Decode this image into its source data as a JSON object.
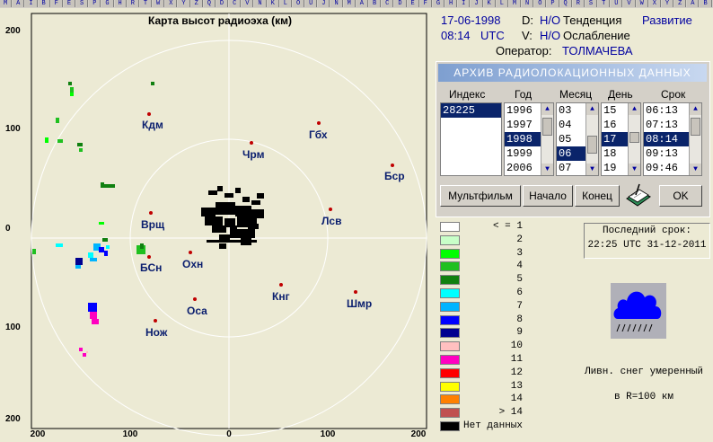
{
  "toolbar": {
    "icons": [
      "M",
      "A",
      "I",
      "B",
      "F",
      "E",
      "S",
      "P",
      "G",
      "H",
      "R",
      "T",
      "W",
      "X",
      "Y",
      "Z",
      "Q",
      "D",
      "C",
      "V",
      "N",
      "K",
      "L",
      "O",
      "U",
      "J",
      "N",
      "M",
      "A",
      "B",
      "C",
      "D",
      "E",
      "F",
      "G",
      "H",
      "I",
      "J",
      "K",
      "L",
      "M",
      "N",
      "O",
      "P",
      "Q",
      "R",
      "S",
      "T",
      "U",
      "V",
      "W",
      "X",
      "Y",
      "Z",
      "A",
      "B"
    ]
  },
  "map": {
    "title": "Карта высот радиоэха (км)",
    "y_ticks": [
      "200",
      "100",
      "0",
      "100",
      "200"
    ],
    "x_ticks": [
      "200",
      "100",
      "0",
      "100",
      "200"
    ],
    "stations": [
      "Кдм",
      "Гбх",
      "Чрм",
      "Бср",
      "Врщ",
      "Лсв",
      "БСн",
      "Охн",
      "Кнг",
      "Шмр",
      "Оса",
      "Нож"
    ]
  },
  "info": {
    "date": "17-06-1998",
    "time": "08:14",
    "utc": "UTC",
    "d_label": "D:",
    "d_value": "Н/О",
    "tendency_label": "Тенденция",
    "tendency_value": "Развитие",
    "v_label": "V:",
    "v_value": "Н/О",
    "attenuation_label": "Ослабление",
    "operator_label": "Оператор:",
    "operator_value": "ТОЛМАЧЕВА"
  },
  "archive": {
    "title": "АРХИВ  РАДИОЛОКАЦИОННЫХ  ДАННЫХ",
    "headers": {
      "index": "Индекс",
      "year": "Год",
      "month": "Месяц",
      "day": "День",
      "term": "Срок"
    },
    "index_items": [
      "28225"
    ],
    "year_items": [
      "1996",
      "1997",
      "1998",
      "1999",
      "2006"
    ],
    "month_items": [
      "03",
      "04",
      "05",
      "06",
      "07"
    ],
    "day_items": [
      "15",
      "16",
      "17",
      "18",
      "19"
    ],
    "term_items": [
      "06:13",
      "07:13",
      "08:14",
      "09:13",
      "09:46"
    ],
    "buttons": {
      "multfilm": "Мультфильм",
      "start": "Начало",
      "end": "Конец",
      "ok": "OK"
    }
  },
  "legend": {
    "items": [
      {
        "label": "< = 1",
        "color": "#FFFFFF"
      },
      {
        "label": "2",
        "color": "#C8FFC8"
      },
      {
        "label": "3",
        "color": "#00FF00"
      },
      {
        "label": "4",
        "color": "#20C020"
      },
      {
        "label": "5",
        "color": "#108010"
      },
      {
        "label": "6",
        "color": "#00FFFF"
      },
      {
        "label": "7",
        "color": "#00B4FF"
      },
      {
        "label": "8",
        "color": "#0000FF"
      },
      {
        "label": "9",
        "color": "#000090"
      },
      {
        "label": "10",
        "color": "#FFC0C0"
      },
      {
        "label": "11",
        "color": "#FF00C0"
      },
      {
        "label": "12",
        "color": "#FF0000"
      },
      {
        "label": "13",
        "color": "#FFFF00"
      },
      {
        "label": "14",
        "color": "#FF8000"
      },
      {
        "label": "> 14",
        "color": "#C05050"
      },
      {
        "label": "Нет данных",
        "color": "#000000"
      }
    ]
  },
  "status": {
    "last_label": "Последний срок:",
    "last_value": "22:25 UTC 31-12-2011"
  },
  "weather": {
    "line1": "Ливн. снег умеренный",
    "line2": "в R=100 км"
  }
}
